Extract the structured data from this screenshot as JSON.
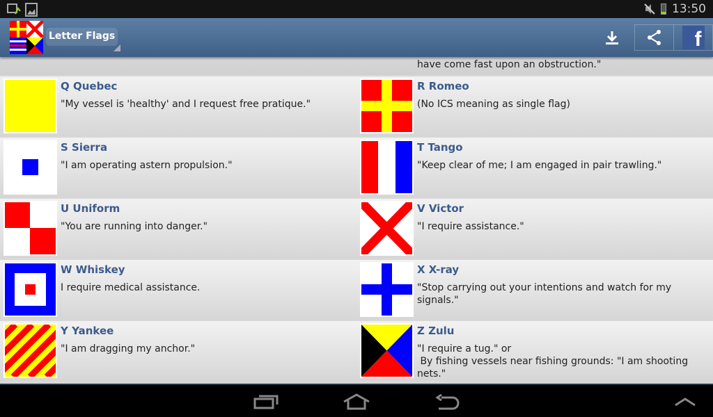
{
  "status_bar": {
    "time": "13:50",
    "icons": [
      "screen-rotate-icon",
      "gallery-icon",
      "mute-icon",
      "battery-icon"
    ]
  },
  "action_bar": {
    "title": "Letter Flags",
    "actions": [
      "download-icon",
      "share-icon",
      "facebook-icon"
    ],
    "facebook_label": "f"
  },
  "partial_item": {
    "meaning": "At sea it may be used by fishing vessels to mean: \"My nets have come fast upon an obstruction.\""
  },
  "flags": [
    {
      "name": "Q Quebec",
      "meaning": "\"My vessel is 'healthy' and I request free pratique.\""
    },
    {
      "name": "R Romeo",
      "meaning": "(No ICS meaning as single flag)"
    },
    {
      "name": "S Sierra",
      "meaning": "\"I am operating astern propulsion.\""
    },
    {
      "name": "T Tango",
      "meaning": "\"Keep clear of me; I am engaged in pair trawling.\""
    },
    {
      "name": "U Uniform",
      "meaning": "\"You are running into danger.\""
    },
    {
      "name": "V Victor",
      "meaning": "\"I require assistance.\""
    },
    {
      "name": "W Whiskey",
      "meaning": "I require medical assistance."
    },
    {
      "name": "X X-ray",
      "meaning": "\"Stop carrying out your intentions and watch for my signals.\""
    },
    {
      "name": "Y Yankee",
      "meaning": "\"I am dragging my anchor.\""
    },
    {
      "name": "Z Zulu",
      "meaning": "\"I require a tug.\" or\n By fishing vessels near fishing grounds: \"I am shooting nets.\""
    }
  ],
  "nav_bar": {
    "buttons": [
      "recent-apps-icon",
      "home-icon",
      "back-icon",
      "menu-up-icon"
    ]
  },
  "colors": {
    "header": "#4a6b92",
    "name_text": "#3b5b8c",
    "flag_red": "#ff0000",
    "flag_yellow": "#ffff00",
    "flag_blue": "#0000ff"
  }
}
